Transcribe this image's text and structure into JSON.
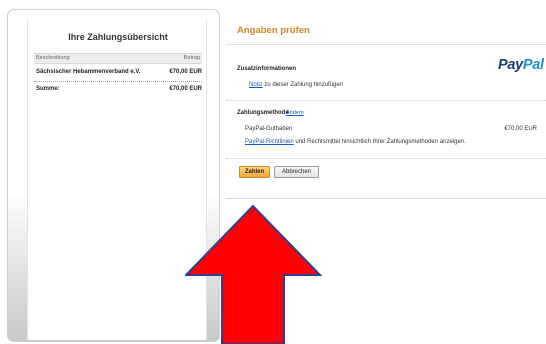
{
  "summary": {
    "title": "Ihre Zahlungsübersicht",
    "header_description": "Beschreibung",
    "header_amount": "Betrag",
    "item_description": "Sächsischer Hebammenverband e.V.",
    "item_amount": "€70,00 EUR",
    "total_label": "Summe:",
    "total_amount": "€70,00 EUR"
  },
  "review": {
    "title": "Angaben prüfen",
    "logo_part1": "Pay",
    "logo_part2": "Pal",
    "additional_info_label": "Zusatzinformationen",
    "note_link": "Notiz",
    "note_text": " zu dieser Zahlung hinzufügen",
    "payment_method_label": "Zahlungsmethode",
    "change_link": "Ändern",
    "balance_label": "PayPal-Guthaben",
    "balance_amount": "€70,00 EUR",
    "policy_link": "PayPal-Richtlinien",
    "policy_text": " und Rechtsmittel hinsichtlich Ihrer Zahlungsmethoden anzeigen.",
    "pay_button": "Zahlen",
    "cancel_button": "Abbrechen"
  },
  "colors": {
    "section_title": "#d38426",
    "link": "#1b55b5",
    "arrow_fill": "#ff0000",
    "arrow_stroke": "#2f3f8f"
  }
}
